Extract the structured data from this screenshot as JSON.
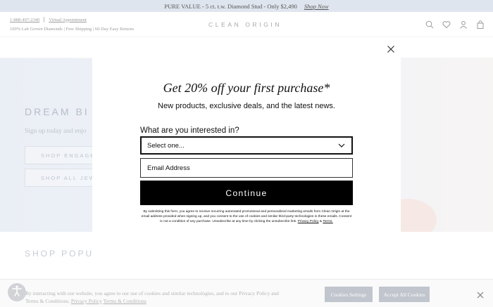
{
  "promo": {
    "text": "PURE VALUE - 5 ct. t.w. Diamond Stud - Only $2,490",
    "link": "Shop Now"
  },
  "header": {
    "phone": "1-888-497-2340",
    "appointment": "Virtual Appointment",
    "tagline": "100% Lab Grown Diamonds | Free Shipping | 60-Day Easy Returns",
    "logo": "CLEAN ORIGIN",
    "icons": [
      "search-icon",
      "heart-icon",
      "user-icon",
      "bag-icon"
    ]
  },
  "hero": {
    "title": "DREAM BI",
    "subtitle": "Sign up today and enjo",
    "btn_engagement": "SHOP ENGAGEM",
    "btn_jewelry": "SHOP ALL JEWE"
  },
  "popular": {
    "title": "SHOP POPU"
  },
  "cookie": {
    "text": "By interacting with our website, you agree to our use of cookies and similar technologies, and to our Privacy Policy and Terms & Conditions.",
    "privacy_link": "Privacy Policy",
    "terms_link": "Terms & Conditions",
    "settings_label": "Cookies Settings",
    "accept_label": "Accept All Cookies"
  },
  "modal": {
    "title": "Get 20% off your first purchase*",
    "subtitle": "New products, exclusive deals, and the latest news.",
    "question": "What are you interested in?",
    "select_value": "Select one...",
    "email_placeholder": "Email Address",
    "continue_label": "Continue",
    "legal_text": "By submitting this form, you agree to receive recurring automated promotional and personalized marketing emails from Clean Origin at the email address provided when signing up, and you consent to the use of cookies and similar third-party technologies in these emails. Consent is not a condition of any purchase. Unsubscribe at any time by clicking the unsubscribe link.",
    "legal_privacy": "Privacy Policy",
    "legal_amp": "&",
    "legal_terms": "Terms."
  },
  "colors": {
    "accent": "#000000",
    "hero_bg": "#e3e9f1",
    "promo_bg": "#dfe5ee",
    "cookie_btn": "#a0a7b2"
  }
}
